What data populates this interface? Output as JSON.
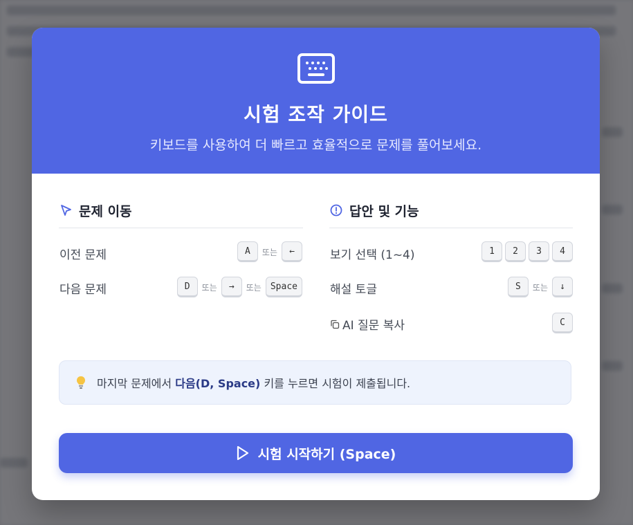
{
  "dialog": {
    "title": "시험 조작 가이드",
    "subtitle": "키보드를 사용하여 더 빠르고 효율적으로 문제를 풀어보세요."
  },
  "navigation": {
    "heading": "문제 이동",
    "rows": [
      {
        "label": "이전 문제",
        "keys": [
          "A",
          "←"
        ],
        "separator": "또는"
      },
      {
        "label": "다음 문제",
        "keys": [
          "D",
          "→",
          "Space"
        ],
        "separator": "또는"
      }
    ]
  },
  "answers": {
    "heading": "답안 및 기능",
    "rows": [
      {
        "label": "보기 선택 (1~4)",
        "keys": [
          "1",
          "2",
          "3",
          "4"
        ]
      },
      {
        "label": "해설 토글",
        "keys": [
          "S",
          "↓"
        ],
        "separator": "또는"
      },
      {
        "label": "AI 질문 복사",
        "keys": [
          "C"
        ]
      }
    ]
  },
  "tip": {
    "prefix": "마지막 문제에서",
    "emphasis": "다음(D, Space)",
    "suffix": "키를 누르면 시험이 제출됩니다."
  },
  "start_button": {
    "label": "시험 시작하기 (Space)"
  },
  "colors": {
    "accent": "#5066e3",
    "tip_bg": "#eef3fd"
  },
  "icons": [
    "keyboard-icon",
    "cursor-icon",
    "alert-circle-icon",
    "copy-icon",
    "lightbulb-icon",
    "play-icon"
  ]
}
